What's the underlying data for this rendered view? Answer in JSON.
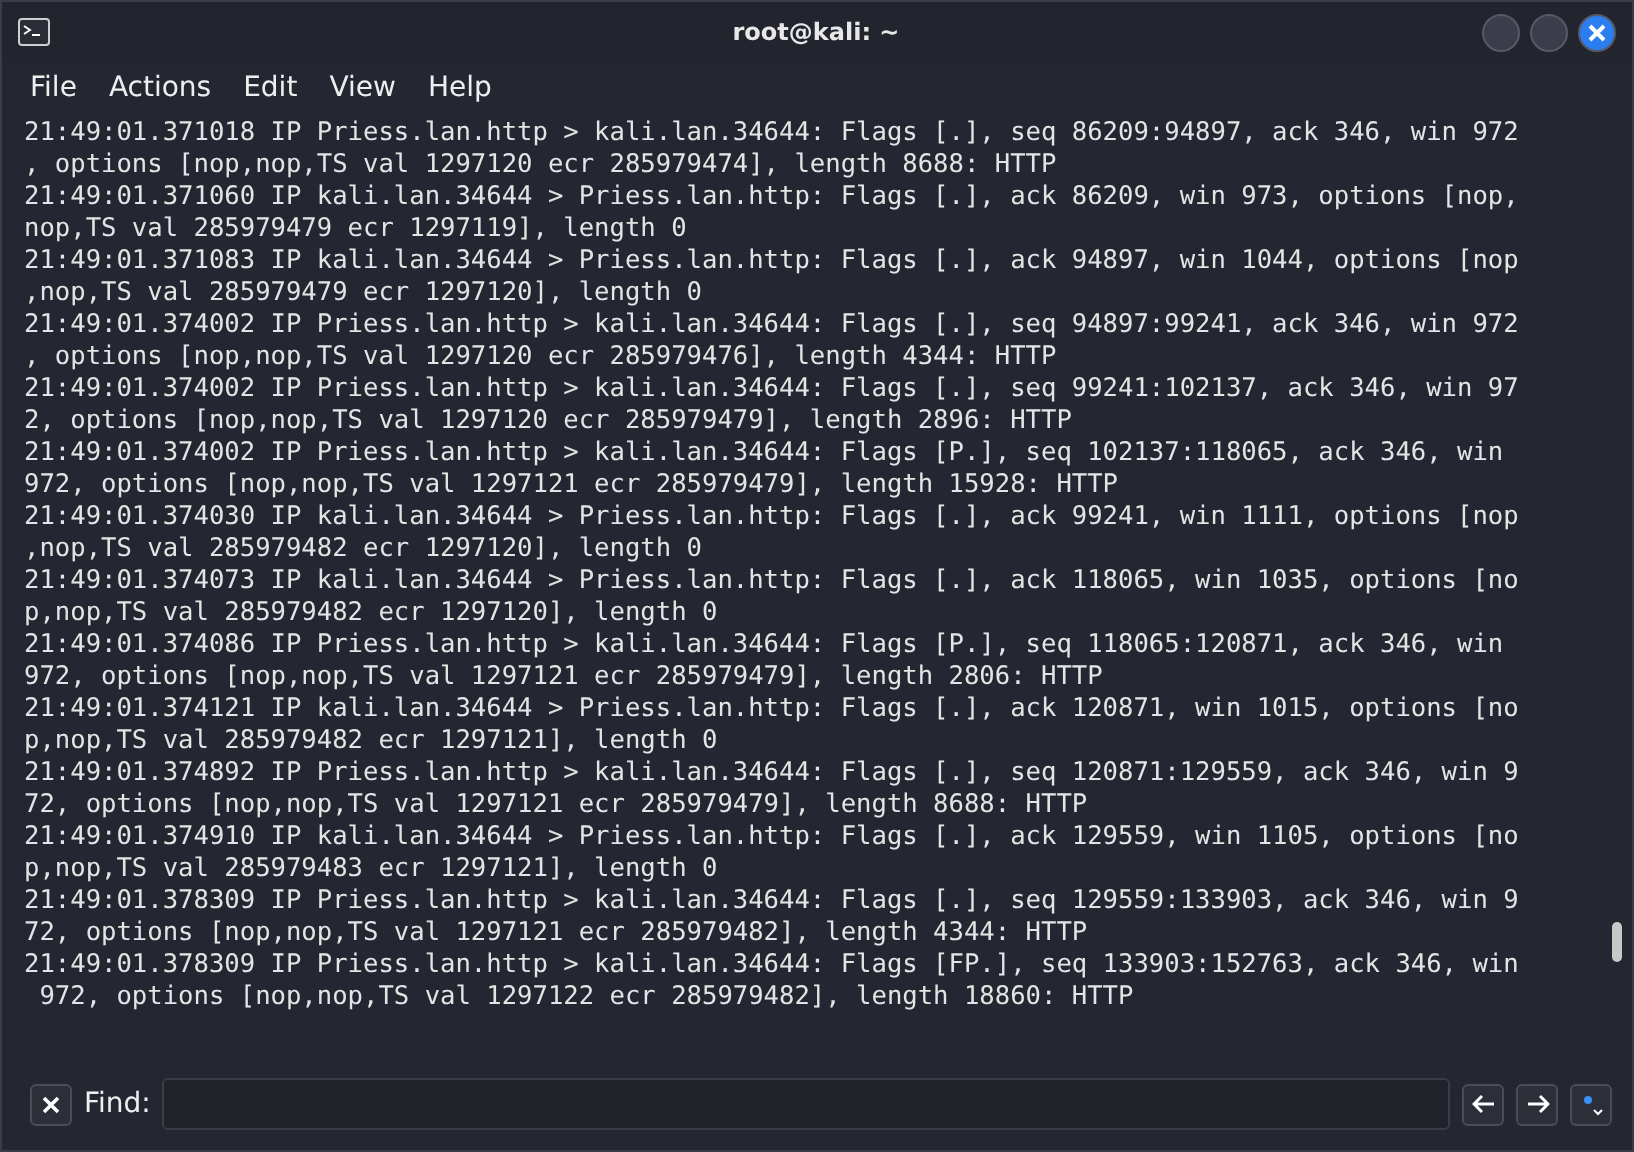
{
  "window": {
    "title": "root@kali: ~"
  },
  "menu": [
    "File",
    "Actions",
    "Edit",
    "View",
    "Help"
  ],
  "terminal_lines": [
    "21:49:01.371018 IP Priess.lan.http > kali.lan.34644: Flags [.], seq 86209:94897, ack 346, win 972",
    ", options [nop,nop,TS val 1297120 ecr 285979474], length 8688: HTTP",
    "21:49:01.371060 IP kali.lan.34644 > Priess.lan.http: Flags [.], ack 86209, win 973, options [nop,",
    "nop,TS val 285979479 ecr 1297119], length 0",
    "21:49:01.371083 IP kali.lan.34644 > Priess.lan.http: Flags [.], ack 94897, win 1044, options [nop",
    ",nop,TS val 285979479 ecr 1297120], length 0",
    "21:49:01.374002 IP Priess.lan.http > kali.lan.34644: Flags [.], seq 94897:99241, ack 346, win 972",
    ", options [nop,nop,TS val 1297120 ecr 285979476], length 4344: HTTP",
    "21:49:01.374002 IP Priess.lan.http > kali.lan.34644: Flags [.], seq 99241:102137, ack 346, win 97",
    "2, options [nop,nop,TS val 1297120 ecr 285979479], length 2896: HTTP",
    "21:49:01.374002 IP Priess.lan.http > kali.lan.34644: Flags [P.], seq 102137:118065, ack 346, win",
    "972, options [nop,nop,TS val 1297121 ecr 285979479], length 15928: HTTP",
    "21:49:01.374030 IP kali.lan.34644 > Priess.lan.http: Flags [.], ack 99241, win 1111, options [nop",
    ",nop,TS val 285979482 ecr 1297120], length 0",
    "21:49:01.374073 IP kali.lan.34644 > Priess.lan.http: Flags [.], ack 118065, win 1035, options [no",
    "p,nop,TS val 285979482 ecr 1297120], length 0",
    "21:49:01.374086 IP Priess.lan.http > kali.lan.34644: Flags [P.], seq 118065:120871, ack 346, win",
    "972, options [nop,nop,TS val 1297121 ecr 285979479], length 2806: HTTP",
    "21:49:01.374121 IP kali.lan.34644 > Priess.lan.http: Flags [.], ack 120871, win 1015, options [no",
    "p,nop,TS val 285979482 ecr 1297121], length 0",
    "21:49:01.374892 IP Priess.lan.http > kali.lan.34644: Flags [.], seq 120871:129559, ack 346, win 9",
    "72, options [nop,nop,TS val 1297121 ecr 285979479], length 8688: HTTP",
    "21:49:01.374910 IP kali.lan.34644 > Priess.lan.http: Flags [.], ack 129559, win 1105, options [no",
    "p,nop,TS val 285979483 ecr 1297121], length 0",
    "21:49:01.378309 IP Priess.lan.http > kali.lan.34644: Flags [.], seq 129559:133903, ack 346, win 9",
    "72, options [nop,nop,TS val 1297121 ecr 285979482], length 4344: HTTP",
    "21:49:01.378309 IP Priess.lan.http > kali.lan.34644: Flags [FP.], seq 133903:152763, ack 346, win",
    " 972, options [nop,nop,TS val 1297122 ecr 285979482], length 18860: HTTP"
  ],
  "find_bar": {
    "label": "Find:"
  }
}
